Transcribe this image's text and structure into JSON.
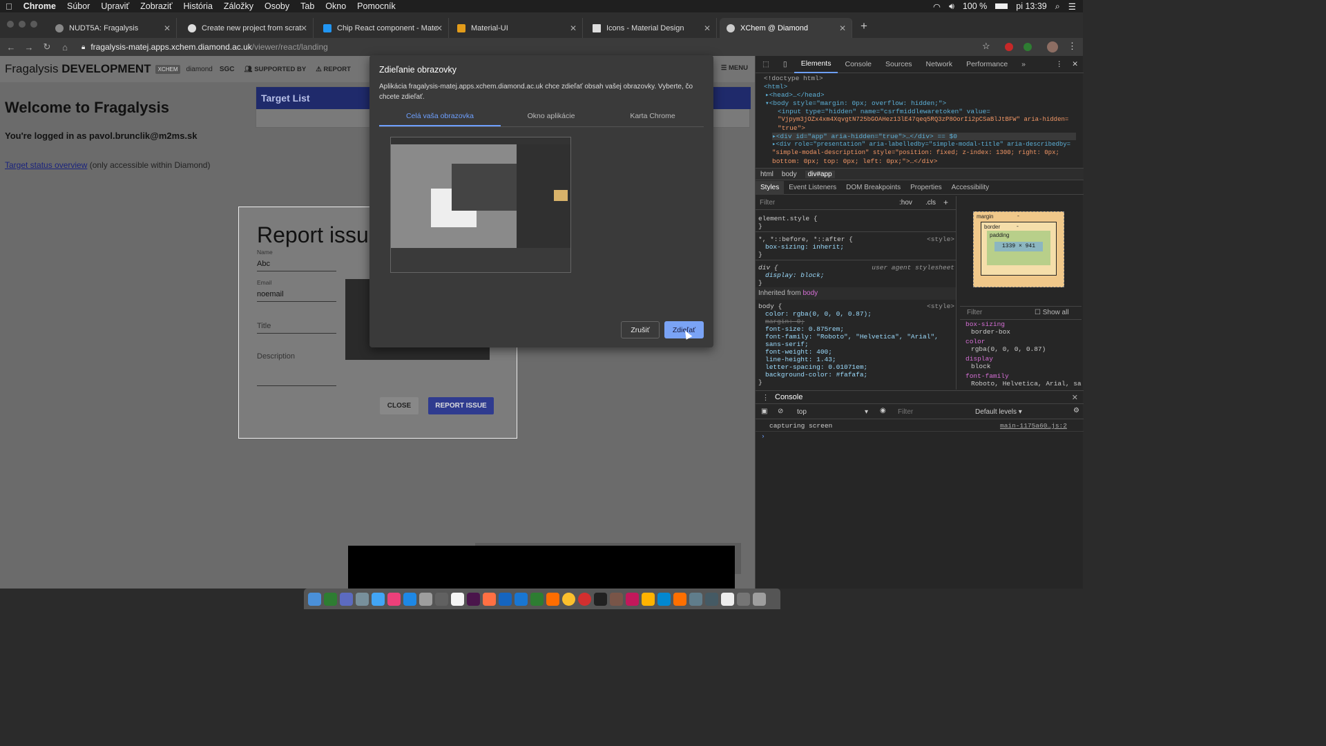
{
  "menubar": {
    "app": "Chrome",
    "items": [
      "Súbor",
      "Upraviť",
      "Zobraziť",
      "História",
      "Záložky",
      "Osoby",
      "Tab",
      "Okno",
      "Pomocník"
    ],
    "battery": "100 %",
    "clock": "pi 13:39"
  },
  "tabs": [
    {
      "label": "NUDT5A: Fragalysis"
    },
    {
      "label": "Create new project from scratch"
    },
    {
      "label": "Chip React component - Materia"
    },
    {
      "label": "Material-UI"
    },
    {
      "label": "Icons - Material Design"
    },
    {
      "label": "XChem @ Diamond"
    }
  ],
  "new_tab": "+",
  "omnibox": {
    "host": "fragalysis-matej.apps.xchem.diamond.ac.uk",
    "path": "/viewer/react/landing"
  },
  "app": {
    "brand_prefix": "Fragalysis ",
    "brand_bold": "DEVELOPMENT",
    "logo_diamond": "diamond",
    "logo_sgc": "SGC",
    "supported_by": "SUPPORTED BY",
    "report": "REPORT",
    "menu": "MENU",
    "welcome": "Welcome to Fragalysis",
    "logged_in": "You're logged in as pavol.brunclik@m2ms.sk",
    "status_link": "Target status overview",
    "status_note": " (only accessible within Diamond)",
    "target_list": "Target List"
  },
  "report_dialog": {
    "title": "Report issue",
    "name_label": "Name",
    "name_value": "Abc",
    "email_label": "Email",
    "email_value": "noemail",
    "title_placeholder": "Title",
    "description_placeholder": "Description",
    "close": "CLOSE",
    "submit": "REPORT ISSUE"
  },
  "share_dialog": {
    "title": "Zdieľanie obrazovky",
    "description": "Aplikácia fragalysis-matej.apps.xchem.diamond.ac.uk chce zdieľať obsah vašej obrazovky. Vyberte, čo chcete zdieľať.",
    "tabs": [
      "Celá vaša obrazovka",
      "Okno aplikácie",
      "Karta Chrome"
    ],
    "cancel": "Zrušiť",
    "share": "Zdieľať"
  },
  "devtools": {
    "tabs": [
      "Elements",
      "Console",
      "Sources",
      "Network",
      "Performance",
      "»"
    ],
    "dom_lines": [
      "<!doctype html>",
      "<html>",
      "▸<head>…</head>",
      "▾<body style=\"margin: 0px; overflow: hidden;\">",
      "<input type=\"hidden\" name=\"csrfmiddlewaretoken\" value=",
      "\"Vjpym3jOZx4xm4XqvgtN725bGOAHez13lE47qeq5RQ3zP8OorIi2pCSaBlJtBFW\" aria-hidden=",
      "\"true\">",
      "▸<div id=\"app\" aria-hidden=\"true\">…</div> == $0",
      "▸<div role=\"presentation\" aria-labelledby=\"simple-modal-title\" aria-describedby=",
      "\"simple-modal-description\" style=\"position: fixed; z-index: 1300; right: 0px;",
      "bottom: 0px; top: 0px; left: 0px;\">…</div>"
    ],
    "breadcrumbs": [
      "html",
      "body",
      "div#app"
    ],
    "subtabs": [
      "Styles",
      "Event Listeners",
      "DOM Breakpoints",
      "Properties",
      "Accessibility"
    ],
    "filter_placeholder": "Filter",
    "hov": ":hov",
    "cls": ".cls",
    "styles": [
      {
        "sel": "element.style {",
        "src": ""
      },
      {
        "sel": "}",
        "src": ""
      },
      {
        "sel": "*, *::before, *::after {",
        "src": "<style>"
      },
      {
        "sel": "  box-sizing: inherit;",
        "src": ""
      },
      {
        "sel": "}",
        "src": ""
      },
      {
        "sel": "div {",
        "src": "user agent stylesheet"
      },
      {
        "sel": "  display: block;",
        "src": ""
      },
      {
        "sel": "}",
        "src": ""
      }
    ],
    "inherited_from": "Inherited from",
    "inherited_tag": "body",
    "body_rules": [
      "body {",
      "  color: rgba(0, 0, 0, 0.87);",
      "  margin: 0;",
      "  font-size: 0.875rem;",
      "  font-family: \"Roboto\", \"Helvetica\", \"Arial\",",
      "      sans-serif;",
      "  font-weight: 400;",
      "  line-height: 1.43;",
      "  letter-spacing: 0.01071em;",
      "  background-color: #fafafa;",
      "}"
    ],
    "body_src": "<style>",
    "boxmodel": {
      "margin": "margin",
      "border": "border",
      "padding": "padding",
      "content": "1339 × 941",
      "dash": "-"
    },
    "computed_filter": "Filter",
    "show_all": "Show all",
    "computed": [
      {
        "prop": "box-sizing",
        "val": "border-box"
      },
      {
        "prop": "color",
        "val": "rgba(0, 0, 0, 0.87)"
      },
      {
        "prop": "display",
        "val": "block"
      },
      {
        "prop": "font-family",
        "val": "Roboto, Helvetica, Arial, sa"
      }
    ],
    "console_tab": "Console",
    "console_context": "top",
    "console_filter": "Filter",
    "console_levels": "Default levels ▾",
    "console_msg": "capturing screen",
    "console_src": "main-1175a60…js:2",
    "prompt": "›"
  },
  "colors": {
    "accent": "#6ea0ff",
    "report_button": "#2f3b8f",
    "target_header": "#1f2a6b"
  }
}
